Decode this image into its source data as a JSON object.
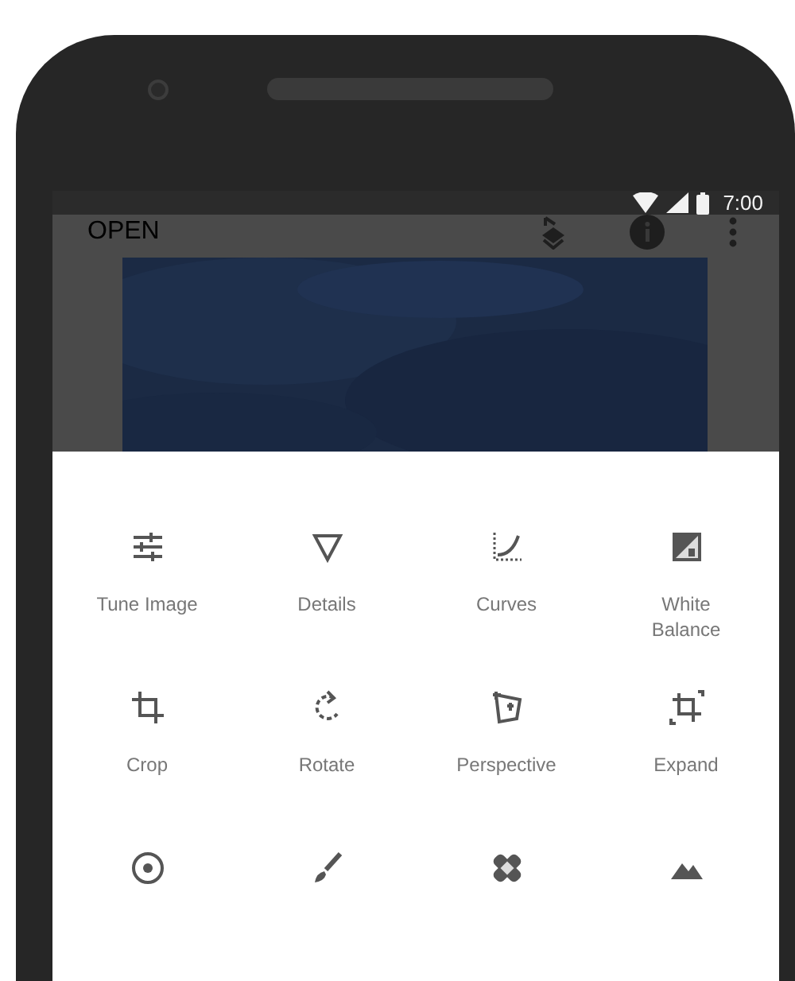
{
  "status_bar": {
    "time": "7:00"
  },
  "app_bar": {
    "title": "OPEN"
  },
  "tools": [
    {
      "label": "Tune Image"
    },
    {
      "label": "Details"
    },
    {
      "label": "Curves"
    },
    {
      "label": "White Balance"
    },
    {
      "label": "Crop"
    },
    {
      "label": "Rotate"
    },
    {
      "label": "Perspective"
    },
    {
      "label": "Expand"
    }
  ]
}
